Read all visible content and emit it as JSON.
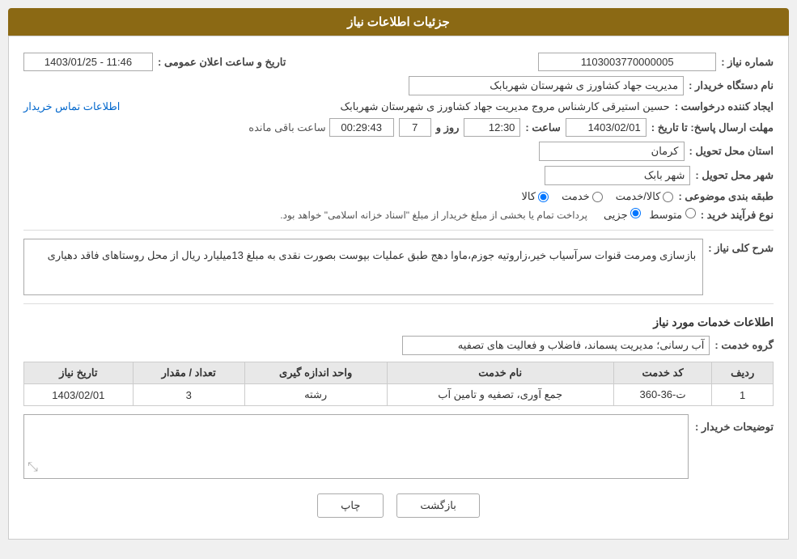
{
  "header": {
    "title": "جزئیات اطلاعات نیاز"
  },
  "fields": {
    "need_number_label": "شماره نیاز :",
    "need_number_value": "1103003770000005",
    "announcement_label": "تاریخ و ساعت اعلان عمومی :",
    "announcement_value": "1403/01/25 - 11:46",
    "buyer_org_label": "نام دستگاه خریدار :",
    "buyer_org_value": "مدیریت جهاد کشاورز ی شهرستان شهربابک",
    "requester_label": "ایجاد کننده درخواست :",
    "requester_value": "حسین استیرقی کارشناس مروج مدیریت جهاد کشاورز ی شهرستان شهربابک",
    "contact_link": "اطلاعات تماس خریدار",
    "deadline_label": "مهلت ارسال پاسخ: تا تاریخ :",
    "deadline_date": "1403/02/01",
    "deadline_time_label": "ساعت :",
    "deadline_time": "12:30",
    "deadline_day_label": "روز و",
    "deadline_days": "7",
    "remaining_label": "ساعت باقی مانده",
    "remaining_time": "00:29:43",
    "province_label": "استان محل تحویل :",
    "province_value": "کرمان",
    "city_label": "شهر محل تحویل :",
    "city_value": "شهر بابک",
    "category_label": "طبقه بندی موضوعی :",
    "category_kala": "کالا",
    "category_khedmat": "خدمت",
    "category_kala_khedmat": "کالا/خدمت",
    "process_label": "نوع فرآیند خرید :",
    "process_jozi": "جزیی",
    "process_motavaset": "متوسط",
    "process_note": "پرداخت تمام یا بخشی از مبلغ خریدار از مبلغ \"اسناد خزانه اسلامی\" خواهد بود.",
    "description_label": "شرح کلی نیاز :",
    "description_value": "بازسازی ومرمت قنوات سرآسیاب خیر،زاروتیه جوزم،ماوا دهج طبق عملیات بپوست بصورت نقدی به مبلغ 13میلیارد ریال از محل روستاهای فاقد دهیاری",
    "services_section_title": "اطلاعات خدمات مورد نیاز",
    "service_group_label": "گروه خدمت :",
    "service_group_value": "آب رسانی؛ مدیریت پسماند، فاضلاب و فعالیت های تصفیه",
    "table_headers": {
      "row_num": "ردیف",
      "service_code": "کد خدمت",
      "service_name": "نام خدمت",
      "unit": "واحد اندازه گیری",
      "quantity": "تعداد / مقدار",
      "date": "تاریخ نیاز"
    },
    "table_rows": [
      {
        "row": "1",
        "service_code": "ت-36-360",
        "service_name": "جمع آوری، تصفیه و تامین آب",
        "unit": "رشته",
        "quantity": "3",
        "date": "1403/02/01"
      }
    ],
    "buyer_notes_label": "توضیحات خریدار :"
  },
  "buttons": {
    "print": "چاپ",
    "back": "بازگشت"
  }
}
